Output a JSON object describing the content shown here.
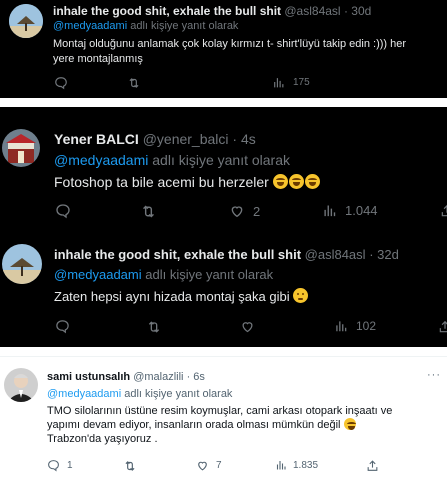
{
  "tweets": [
    {
      "name": "inhale the good shit, exhale the bull shit",
      "handle": "@asl84asl",
      "time": "30d",
      "reply_to": "@medyaadami",
      "reply_suffix": "adlı kişiye yanıt olarak",
      "text_line1": "Montaj olduğunu anlamak çok kolay kırmızı t- shirt'lüyü takip edin :))) her",
      "text_line2": "yere montajlanmış",
      "replies": "",
      "retweets": "",
      "likes": "",
      "views": "175",
      "theme": "dark"
    },
    {
      "name": "Yener BALCI",
      "handle": "@yener_balci",
      "time": "4s",
      "reply_to": "@medyaadami",
      "reply_suffix": "adlı kişiye yanıt olarak",
      "text_line1": "Fotoshop ta bile acemi bu herzeler",
      "replies": "",
      "retweets": "",
      "likes": "2",
      "views": "1.044",
      "theme": "dark"
    },
    {
      "name": "inhale the good shit, exhale the bull shit",
      "handle": "@asl84asl",
      "time": "32d",
      "reply_to": "@medyaadami",
      "reply_suffix": "adlı kişiye yanıt olarak",
      "text_line1": "Zaten hepsi aynı hizada montaj şaka gibi",
      "replies": "",
      "retweets": "",
      "likes": "",
      "views": "102",
      "theme": "dark"
    },
    {
      "name": "sami ustunsalıh",
      "handle": "@malazlili",
      "time": "6s",
      "reply_to": "@medyaadami",
      "reply_suffix": "adlı kişiye yanıt olarak",
      "text_line1": "TMO silolarının üstüne resim koymuşlar, cami arkası otopark inşaatı ve",
      "text_line2": "yapımı devam ediyor, insanların orada olması mümkün değil",
      "text_line3": "Trabzon'da yaşıyoruz .",
      "replies": "1",
      "retweets": "",
      "likes": "7",
      "views": "1.835",
      "theme": "light"
    }
  ],
  "separator": "·",
  "more_label": "···",
  "colors": {
    "accent": "#1d9bf0",
    "dark_bg": "#000000",
    "light_bg": "#ffffff"
  }
}
